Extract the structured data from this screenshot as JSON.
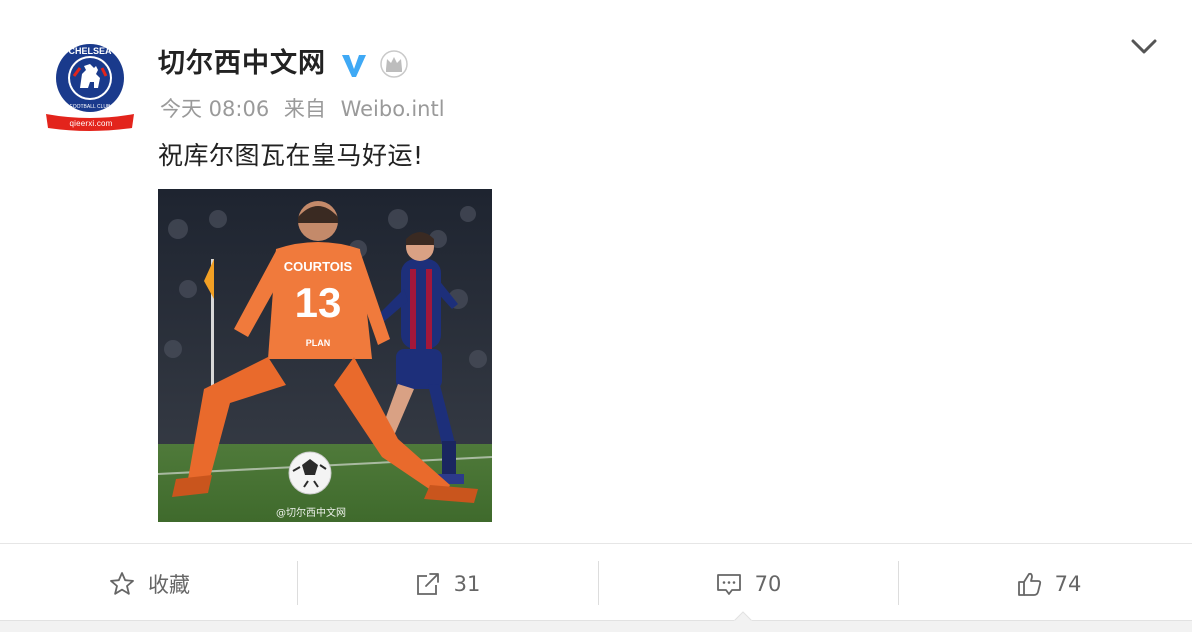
{
  "post": {
    "username": "切尔西中文网",
    "time": "今天 08:06",
    "source_prefix": "来自",
    "source": "Weibo.intl",
    "text": "祝库尔图瓦在皇马好运!",
    "avatar": {
      "domain": "qieerxi.com",
      "badge_text": "CHELSEA",
      "badge_subtext": "FOOTBALL CLUB"
    },
    "photo": {
      "watermark": "@切尔西中文网",
      "shirt_name": "COURTOIS",
      "shirt_number": "13",
      "sponsor": "PLAN"
    }
  },
  "actions": {
    "favorite_label": "收藏",
    "repost_count": "31",
    "comment_count": "70",
    "like_count": "74"
  },
  "icons": {
    "verified": "verified-v-icon",
    "member": "crown-icon",
    "menu": "chevron-down-icon",
    "favorite": "star-icon",
    "repost": "share-arrow-icon",
    "comment": "comment-bubble-icon",
    "like": "thumbs-up-icon"
  },
  "colors": {
    "verified_blue": "#3fa9f5",
    "avatar_red": "#e3241c",
    "avatar_blue": "#1a3a8c",
    "keeper_orange": "#f07a3c",
    "text_primary": "#222222",
    "text_secondary": "#9a9a9a"
  }
}
